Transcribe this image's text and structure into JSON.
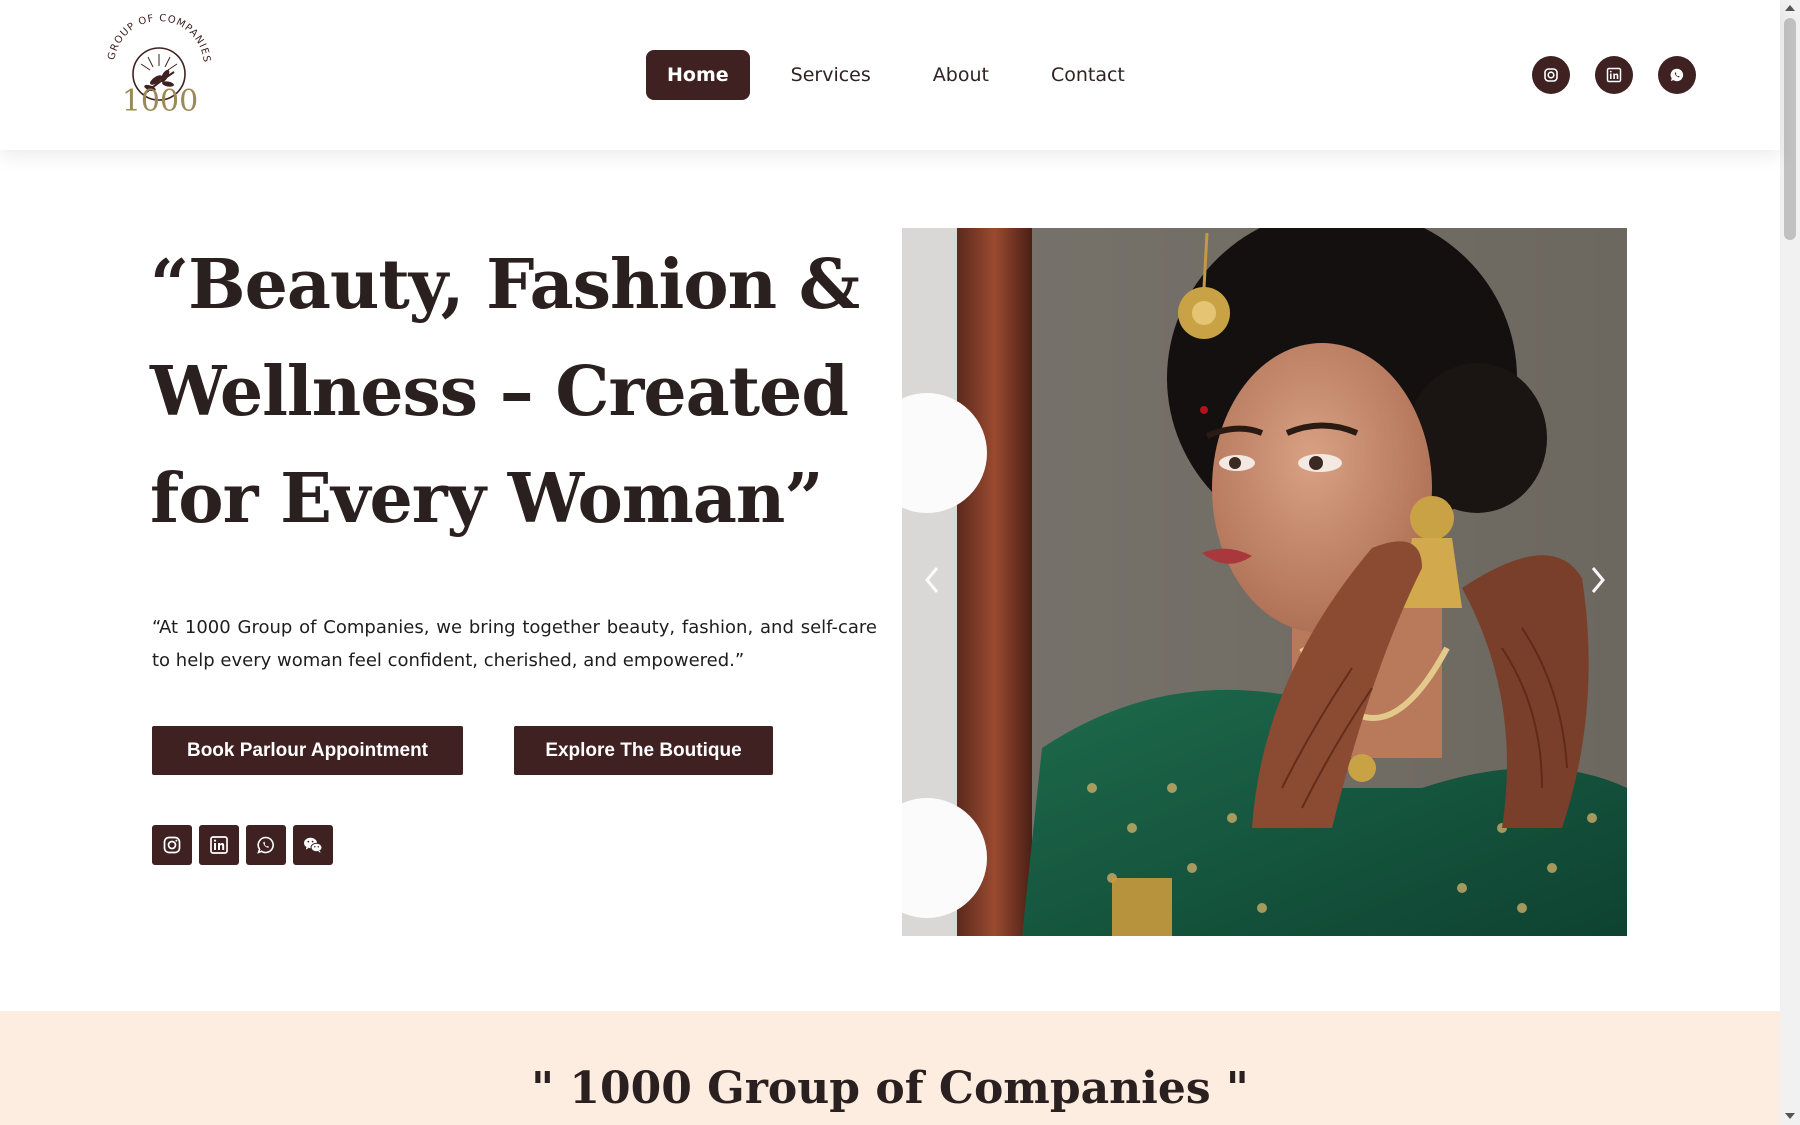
{
  "header": {
    "logo": {
      "arc_text": "GROUP OF COMPANIES",
      "number": "1000"
    },
    "nav": [
      {
        "label": "Home",
        "active": true
      },
      {
        "label": "Services",
        "active": false
      },
      {
        "label": "About",
        "active": false
      },
      {
        "label": "Contact",
        "active": false
      }
    ],
    "social": [
      "instagram-icon",
      "linkedin-icon",
      "whatsapp-icon"
    ]
  },
  "hero": {
    "title": "“Beauty, Fashion & Wellness – Created for Every Woman”",
    "description": "“At 1000 Group of Companies, we bring together beauty, fashion, and self-care to help every woman feel confident, cherished, and empowered.”",
    "buttons": {
      "book": "Book Parlour Appointment",
      "explore": "Explore The Boutique"
    },
    "social": [
      "instagram-icon",
      "linkedin-icon",
      "whatsapp-icon",
      "wechat-icon"
    ]
  },
  "slider": {
    "image": "bride-portrait-with-mehndi-and-green-saree",
    "prev_icon": "chevron-left-icon",
    "next_icon": "chevron-right-icon"
  },
  "section2": {
    "title": "\" 1000 Group of Companies \""
  },
  "colors": {
    "brand": "#3f2121",
    "logo_gold": "#9b8a57",
    "section_bg": "#fcede0"
  }
}
